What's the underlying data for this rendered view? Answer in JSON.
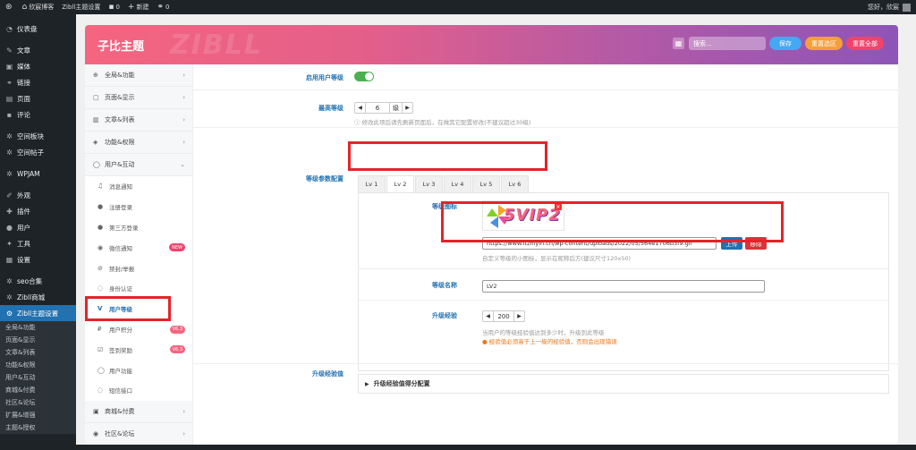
{
  "admin_bar": {
    "site_name": "欣宸博客",
    "settings_link": "Zibll主题设置",
    "comments_count": "0",
    "new_label": "新建",
    "links_count": "0",
    "greeting": "您好，欣宸"
  },
  "admin_menu": {
    "items": [
      {
        "label": "仪表盘",
        "icon": "dashboard-icon"
      },
      {
        "label": "文章",
        "icon": "pin-icon"
      },
      {
        "label": "媒体",
        "icon": "media-icon"
      },
      {
        "label": "链接",
        "icon": "link-icon"
      },
      {
        "label": "页面",
        "icon": "page-icon"
      },
      {
        "label": "评论",
        "icon": "comment-icon"
      },
      {
        "label": "空间板块",
        "icon": "plugin-icon"
      },
      {
        "label": "空间帖子",
        "icon": "plugin-icon"
      },
      {
        "label": "WPJAM",
        "icon": "plugin-icon"
      },
      {
        "label": "外观",
        "icon": "brush-icon"
      },
      {
        "label": "插件",
        "icon": "plugin-icon"
      },
      {
        "label": "用户",
        "icon": "user-icon"
      },
      {
        "label": "工具",
        "icon": "wrench-icon"
      },
      {
        "label": "设置",
        "icon": "settings-icon"
      },
      {
        "label": "seo合集",
        "icon": "plugin-icon"
      },
      {
        "label": "Zibll商城",
        "icon": "plugin-icon"
      },
      {
        "label": "Zibll主题设置",
        "icon": "gear-icon"
      }
    ],
    "sub_items": [
      "全局&功能",
      "页面&显示",
      "文章&列表",
      "功能&权限",
      "用户&互动",
      "商城&付费",
      "社区&论坛",
      "扩展&增强",
      "主题&授权"
    ]
  },
  "panel": {
    "title": "子比主题",
    "watermark": "ZIBLL",
    "search_placeholder": "搜索...",
    "save_label": "保存",
    "reset_section_label": "重置选区",
    "reset_all_label": "重置全部"
  },
  "nav": {
    "sections": [
      {
        "label": "全局&功能",
        "icon": "circle-plus-icon"
      },
      {
        "label": "页面&显示",
        "icon": "calendar-icon"
      },
      {
        "label": "文章&列表",
        "icon": "book-icon"
      },
      {
        "label": "功能&权限",
        "icon": "shield-icon"
      },
      {
        "label": "用户&互动",
        "icon": "user-icon"
      }
    ],
    "user_sub": [
      {
        "label": "消息通知",
        "icon": "bell-icon"
      },
      {
        "label": "注册登录",
        "icon": "user-plus-icon"
      },
      {
        "label": "第三方登录",
        "icon": "users-icon"
      },
      {
        "label": "微信通知",
        "icon": "wechat-icon",
        "badge": "NEW"
      },
      {
        "label": "禁封/举报",
        "icon": "ban-icon"
      },
      {
        "label": "身份认证",
        "icon": "verify-icon"
      },
      {
        "label": "用户等级",
        "icon": "level-icon"
      },
      {
        "label": "用户积分",
        "icon": "points-icon",
        "badge": "V6.3"
      },
      {
        "label": "签到奖励",
        "icon": "checkin-icon",
        "badge": "V6.3"
      },
      {
        "label": "用户功能",
        "icon": "user-icon"
      },
      {
        "label": "短信接口",
        "icon": "sms-icon"
      }
    ],
    "more_sections": [
      {
        "label": "商城&付费",
        "icon": "cart-icon"
      },
      {
        "label": "社区&论坛",
        "icon": "forum-icon"
      }
    ]
  },
  "fields": {
    "enable_level": {
      "label": "启用用户等级",
      "enabled": true
    },
    "max_level": {
      "label": "最高等级",
      "value": "6",
      "unit": "级",
      "help": "修改此项后请先刷新页面后，在做其它配置修改(不建议超过30级)"
    },
    "level_config": {
      "label": "等级参数配置",
      "tabs": [
        "Lv 1",
        "Lv 2",
        "Lv 3",
        "Lv 4",
        "Lv 5",
        "Lv 6"
      ],
      "active_tab": 1,
      "icon_label": "等级图标",
      "preview_text": "5VIP2",
      "icon_url": "https://www.itzhiyin.cn/wp-content/uploads/2022/05/564e1706b3f9.gif",
      "upload_label": "上传",
      "remove_label": "移除",
      "icon_help": "自定义等级的小图标，显示在昵称后方(建议尺寸120x50)",
      "name_label": "等级名称",
      "name_value": "LV2",
      "exp_label": "升级经验",
      "exp_value": "200",
      "exp_help": "当用户的等级经验值达到多少时，升级到此等级",
      "exp_warn": "经验值必须高于上一级的经验值，否则会出现错误"
    },
    "upgrade_exp": {
      "label": "升级经验值",
      "collapse_label": "升级经验值得分配置"
    }
  },
  "colors": {
    "accent": "#2271b1",
    "save": "#44a8f2",
    "reset_section": "#f59f3b",
    "reset_all": "#f1436c",
    "toggle_on": "#4cb04f",
    "highlight": "#e5232a"
  }
}
